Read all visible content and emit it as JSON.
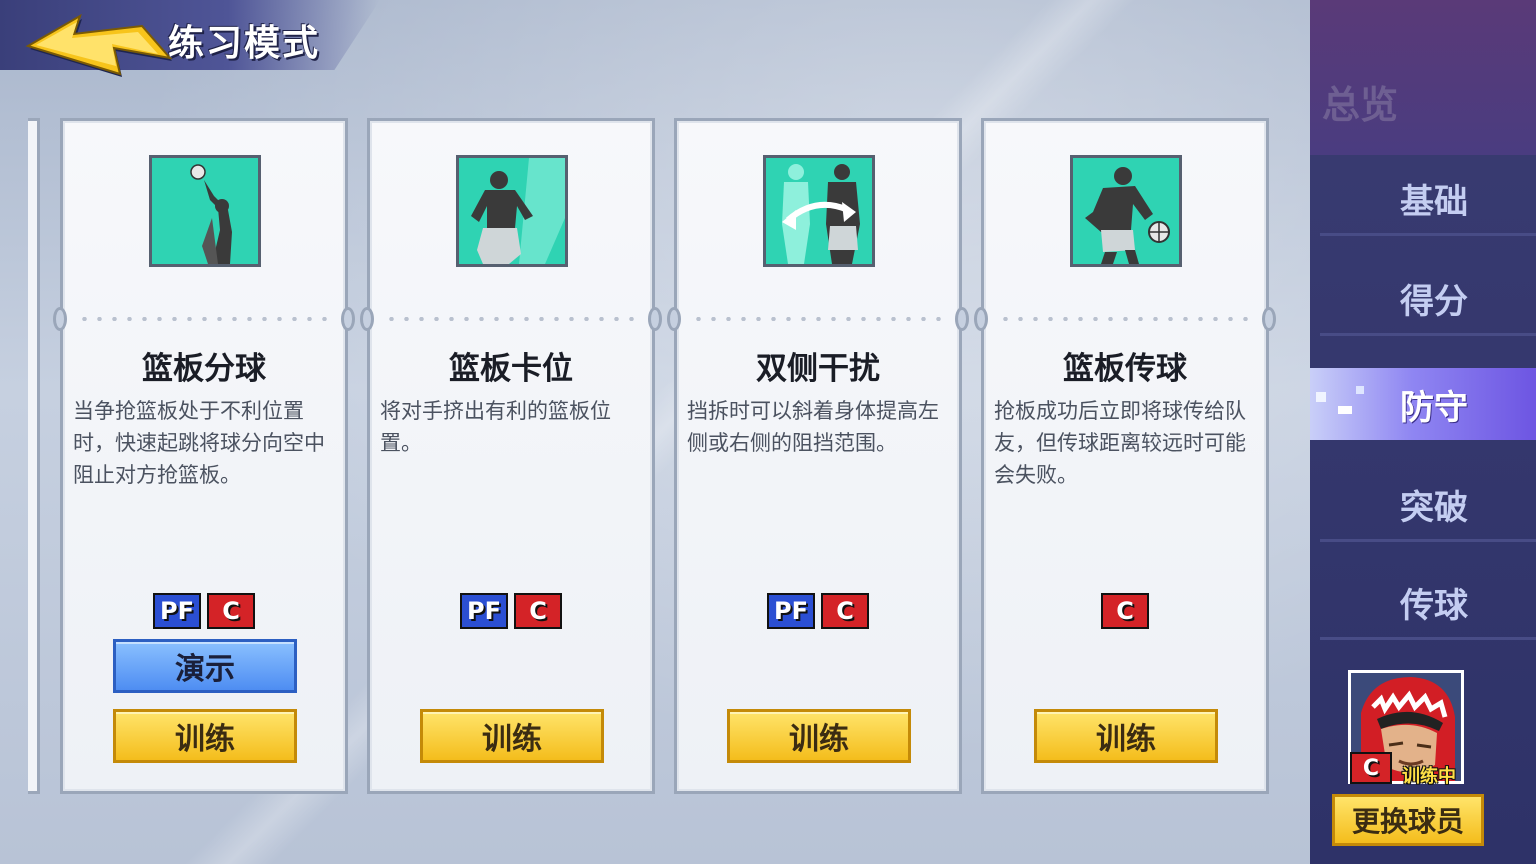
{
  "header": {
    "title": "练习模式"
  },
  "cards": [
    {
      "name": "篮板分球",
      "desc": "当争抢篮板处于不利位置时，快速起跳将球分向空中阻止对方抢篮板。",
      "positions": [
        "PF",
        "C"
      ],
      "demo_label": "演示",
      "train_label": "训练"
    },
    {
      "name": "篮板卡位",
      "desc": "将对手挤出有利的篮板位置。",
      "positions": [
        "PF",
        "C"
      ],
      "train_label": "训练"
    },
    {
      "name": "双侧干扰",
      "desc": "挡拆时可以斜着身体提高左侧或右侧的阻挡范围。",
      "positions": [
        "PF",
        "C"
      ],
      "train_label": "训练"
    },
    {
      "name": "篮板传球",
      "desc": "抢板成功后立即将球传给队友，但传球距离较远时可能会失败。",
      "positions": [
        "C"
      ],
      "train_label": "训练"
    }
  ],
  "sidebar": {
    "overview": "总览",
    "tabs": [
      "基础",
      "得分",
      "防守",
      "突破",
      "传球"
    ],
    "active_tab": "防守"
  },
  "player": {
    "position": "C",
    "status": "训练中",
    "change_label": "更换球员"
  },
  "colors": {
    "icon_bg": "#2fd3b3",
    "pf_badge": "#2b4fd3",
    "c_badge": "#d42327",
    "train_button": "#f4bd1c",
    "demo_button": "#4e8df2",
    "sidebar_bg": "#2e3268"
  },
  "icons": [
    "back-arrow-icon",
    "rebound-tip-icon",
    "box-out-icon",
    "two-side-block-icon",
    "outlet-pass-icon"
  ]
}
